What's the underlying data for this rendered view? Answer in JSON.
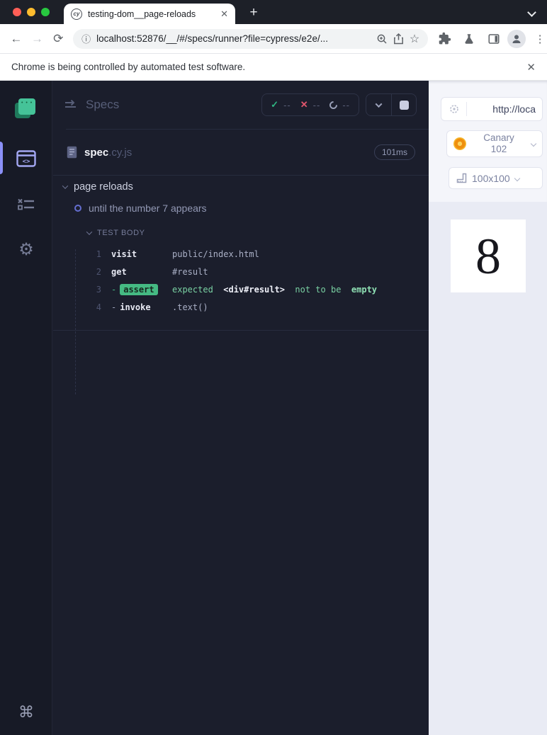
{
  "colors": {
    "accent_green": "#45ba83",
    "accent_red": "#e1566d",
    "accent_indigo": "#8b90f8",
    "reporter_bg": "#1b1e2c",
    "sidebar_bg": "#171a26",
    "aut_bg": "#e9ebf4"
  },
  "browser": {
    "tab_title": "testing-dom__page-reloads",
    "favicon_label": "cy",
    "new_tab_label": "+",
    "url": "localhost:52876/__/#/specs/runner?file=cypress/e2e/...",
    "infobar_text": "Chrome is being controlled by automated test software.",
    "infobar_close": "✕",
    "menu_dots": "⋮",
    "star": "☆",
    "info_glyph": "ⓘ",
    "back_glyph": "←",
    "forward_glyph": "→",
    "reload_glyph": "⟳",
    "tab_close": "✕"
  },
  "sidebar": {
    "logo_dots": "• • •",
    "gear_glyph": "⚙",
    "command_glyph": "⌘"
  },
  "reporter": {
    "header": {
      "title": "Specs",
      "passed_icon": "✓",
      "passed_count": "--",
      "failed_icon": "✕",
      "failed_count": "--",
      "pending_count": "--"
    },
    "spec": {
      "name": "spec",
      "ext": ".cy.js",
      "duration": "101ms"
    },
    "suite": "page reloads",
    "test": "until the number 7 appears",
    "section_label": "TEST BODY",
    "commands": [
      {
        "num": "1",
        "name": "visit",
        "message": "public/index.html"
      },
      {
        "num": "2",
        "name": "get",
        "message": "#result"
      },
      {
        "num": "3",
        "dash": "-",
        "name": "assert",
        "m1": "expected",
        "m2": "<div#result>",
        "m3": "not to be",
        "m4": "empty"
      },
      {
        "num": "4",
        "dash": "-",
        "name": "invoke",
        "message": ".text()"
      }
    ]
  },
  "aut": {
    "url_text": "http://loca",
    "browser_label_line1": "Canary",
    "browser_label_line2": "102",
    "viewport": "100x100",
    "app_value": "8"
  }
}
